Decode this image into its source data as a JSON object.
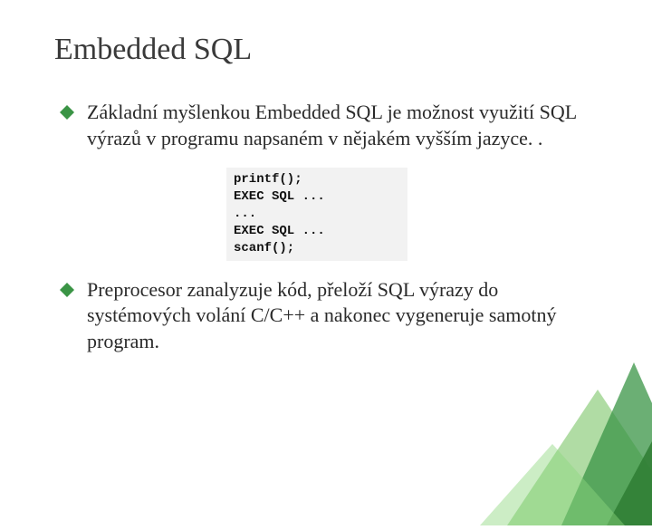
{
  "title": "Embedded SQL",
  "bullets": [
    "Základní myšlenkou Embedded SQL je možnost využití SQL výrazů v programu napsaném v nějakém vyšším jazyce. .",
    "Preprocesor zanalyzuje kód, přeloží SQL výrazy do systémových volání C/C++ a nakonec vygeneruje samotný program."
  ],
  "code": "printf();\nEXEC SQL ...\n...\nEXEC SQL ...\nscanf();",
  "colors": {
    "accent": "#3a9445",
    "accent_light": "#6fbf5a",
    "accent_dark": "#2e7d32"
  }
}
